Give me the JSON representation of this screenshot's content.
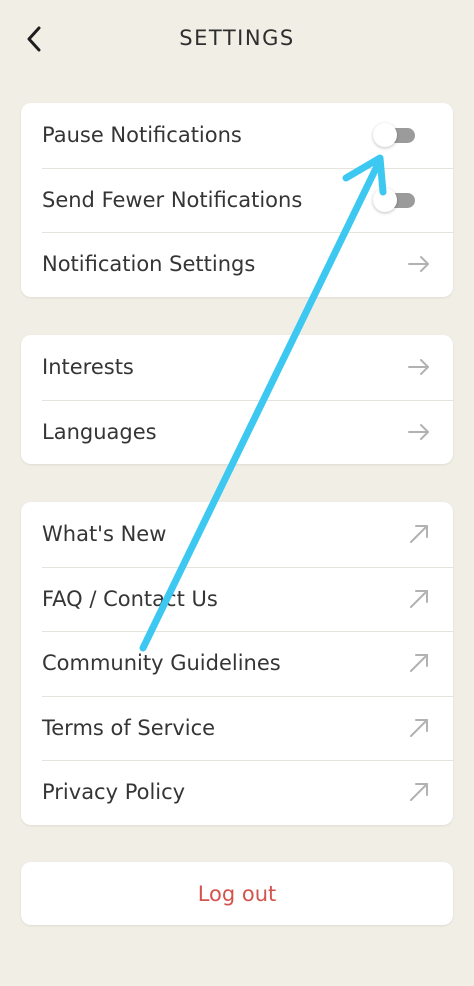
{
  "header": {
    "title": "SETTINGS",
    "back_icon": "chevron-left-icon"
  },
  "notifications_group": {
    "pause_label": "Pause Notifications",
    "pause_on": false,
    "fewer_label": "Send Fewer Notifications",
    "fewer_on": false,
    "settings_label": "Notification Settings"
  },
  "prefs_group": {
    "interests_label": "Interests",
    "languages_label": "Languages"
  },
  "info_group": {
    "whats_new_label": "What's New",
    "faq_label": "FAQ / Contact Us",
    "guidelines_label": "Community Guidelines",
    "terms_label": "Terms of Service",
    "privacy_label": "Privacy Policy"
  },
  "logout": {
    "label": "Log out"
  },
  "colors": {
    "background": "#f1eee5",
    "card": "#ffffff",
    "logout_text": "#d3544f",
    "annotation_arrow": "#3cc8f0"
  }
}
